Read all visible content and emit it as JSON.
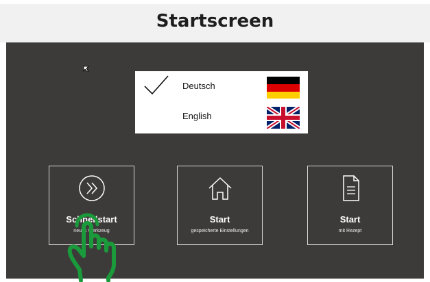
{
  "header": {
    "title": "Startscreen"
  },
  "languages": [
    {
      "label": "Deutsch",
      "selected": true,
      "flag_icon": "germany-flag-icon"
    },
    {
      "label": "English",
      "selected": false,
      "flag_icon": "uk-flag-icon"
    }
  ],
  "tiles": [
    {
      "title": "Schnellstart",
      "subtitle": "neues Werkzeug",
      "icon": "fast-forward-circle-icon"
    },
    {
      "title": "Start",
      "subtitle": "gespeicherte Einstellungen",
      "icon": "home-icon"
    },
    {
      "title": "Start",
      "subtitle": "mit Rezept",
      "icon": "document-icon"
    }
  ],
  "overlay": {
    "icon": "tap-hand-icon",
    "color": "#1a9a3a"
  },
  "colors": {
    "panel": "#3d3b3a",
    "header": "#f1f1f1",
    "tile_border": "#d8d8d8"
  }
}
